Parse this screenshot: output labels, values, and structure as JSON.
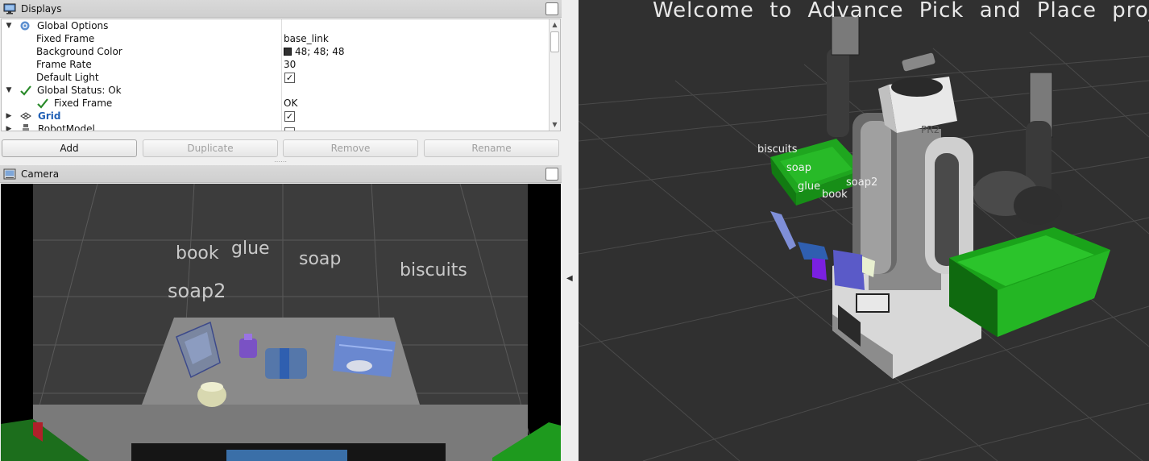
{
  "displays_panel": {
    "title": "Displays",
    "rows": [
      {
        "name": "Global Options",
        "value": ""
      },
      {
        "name": "Fixed Frame",
        "value": "base_link"
      },
      {
        "name": "Background Color",
        "value": "48; 48; 48"
      },
      {
        "name": "Frame Rate",
        "value": "30"
      },
      {
        "name": "Default Light",
        "value": ""
      },
      {
        "name": "Global Status: Ok",
        "value": ""
      },
      {
        "name": "Fixed Frame",
        "value": "OK"
      },
      {
        "name": "Grid",
        "value": ""
      },
      {
        "name": "RobotModel",
        "value": ""
      }
    ],
    "checkbox_mark": "✓",
    "buttons": {
      "add": "Add",
      "duplicate": "Duplicate",
      "remove": "Remove",
      "rename": "Rename"
    }
  },
  "camera_panel": {
    "title": "Camera",
    "labels": {
      "book": "book",
      "glue": "glue",
      "soap": "soap",
      "biscuits": "biscuits",
      "soap2": "soap2"
    }
  },
  "view3d": {
    "welcome": "Welcome to Advance Pick and Place project",
    "labels": {
      "biscuits": "biscuits",
      "soap": "soap",
      "glue": "glue",
      "book": "book",
      "soap2": "soap2"
    }
  },
  "colors": {
    "background": "#303030",
    "bin_green": "#1fa61f",
    "tree_link": "#2160b5"
  },
  "icons": {
    "displays": "monitor-icon",
    "camera": "camera-icon",
    "global_options": "gear-icon",
    "status_ok": "checkmark-icon",
    "grid": "grid-icon",
    "robot_model": "robot-icon",
    "splitter": "collapse-left-arrow-icon"
  }
}
